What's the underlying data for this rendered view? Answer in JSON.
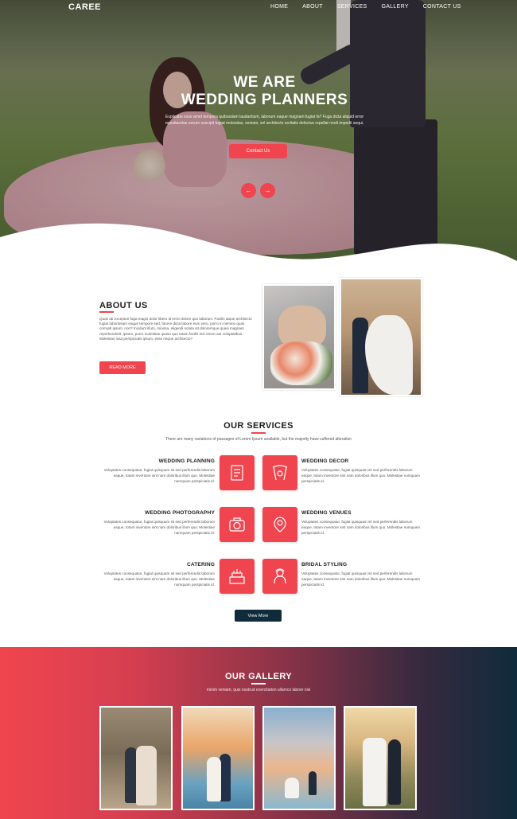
{
  "nav": {
    "logo": "CAREE",
    "items": [
      "HOME",
      "ABOUT",
      "SERVICES",
      "GALLERY",
      "CONTACT US"
    ]
  },
  "hero": {
    "title_line1": "WE ARE",
    "title_line2": "WEDDING PLANNERS",
    "description": "Explicabo esse amet tempora quibusdam laudantium, laborum eaque magnam fugiat fa? Fuga dicta aliquid error repudiandae earum suscipit fugiat molestias, veniam, vel architecto veritatis delectus repellat modi impedit sequi.",
    "button": "Contact Us",
    "prev_arrow": "←",
    "next_arrow": "→"
  },
  "about": {
    "title": "ABOUT US",
    "text": "Quas ab excepturi fuga magni dolor libero id error dolore quo laborum. Facilis atque architecto fugiat laboriosam eaque tempore sed, facere dicta labore eum vero, porro in nemino quas corrupti ipsum, non? Incidunt illum, minima, eligendi soluta sit doloremque quasi magnam reprehenderit, ipsum, porro molestias quaso quo totam facilis nisi rerum aut voluptatibus. Molestias iusa perspiciatis ipsum, esse neque architecto?",
    "button": "READ MORE"
  },
  "services": {
    "title": "OUR SERVICES",
    "subtitle": "There are many variations of passages of Lorem Ipsum available, but the majority have suffered alteration",
    "desc": "Voluptates consequatur, fugiat quisquam sit sed perferendis laborum eaque, totam inventore sint nam doloribus illum quo. Molestiae numquam perspiciatis id.",
    "items": [
      {
        "name": "WEDDING PLANNING",
        "icon": "planning-icon"
      },
      {
        "name": "WEDDING DECOR",
        "icon": "decor-icon"
      },
      {
        "name": "WEDDING PHOTOGRAPHY",
        "icon": "camera-icon"
      },
      {
        "name": "WEDDING VENUES",
        "icon": "venue-icon"
      },
      {
        "name": "CATERING",
        "icon": "catering-icon"
      },
      {
        "name": "BRIDAL STYLING",
        "icon": "bride-icon"
      }
    ],
    "button": "View More"
  },
  "gallery": {
    "title": "OUR GALLERY",
    "subtitle": "minim veniam, quis nostrud exercitation ullamco labore nisi"
  },
  "colors": {
    "accent": "#f0454e",
    "dark": "#0f2b3c"
  }
}
